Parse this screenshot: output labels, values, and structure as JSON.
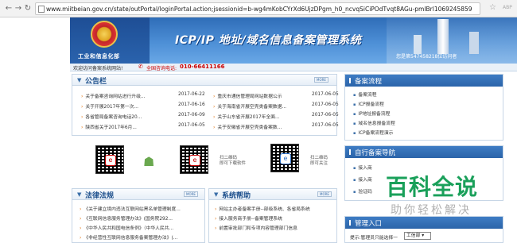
{
  "browser": {
    "url": "www.miitbeian.gov.cn/state/outPortal/loginPortal.action;jsessionid=b-wg4mKobCYrXd6UjzDPgm_h0_ncvqSiCiPOdTvqt8AGu-pmIBrl1069245859"
  },
  "header": {
    "ministry": "工业和信息化部",
    "system_title": "ICP/IP 地址/域名信息备案管理系统",
    "visitor_text": "您是第547458218位访问者"
  },
  "topbar": {
    "welcome": "欢迎访问备案系统网站!",
    "phone_label": "全国咨询电话:",
    "phone": "010-66411166"
  },
  "notices": {
    "title": "公告栏",
    "more": "MORE",
    "left": [
      {
        "title": "关于备案咨询网站进行升级...",
        "date": "2017-06-22"
      },
      {
        "title": "关于开展2017年第一次...",
        "date": "2017-06-16"
      },
      {
        "title": "各省管局备案咨询电话20...",
        "date": "2017-06-09"
      },
      {
        "title": "陕西省关于2017年6月...",
        "date": "2017-06-05"
      }
    ],
    "right": [
      {
        "title": "重庆市通信管理局网站数据公示",
        "date": "2017-06-05"
      },
      {
        "title": "关于海南省开展空壳类备案数据...",
        "date": "2017-06-05"
      },
      {
        "title": "关于山东省开展2017年全面...",
        "date": "2017-06-05"
      },
      {
        "title": "关于安徽省开展空壳类备案数...",
        "date": "2017-06-05"
      }
    ]
  },
  "downloads": {
    "app_label_1": "扫二维码",
    "app_label_2": "即可下载软件",
    "follow_label_1": "扫二维码",
    "follow_label_2": "即可关注"
  },
  "laws": {
    "title": "法律法规",
    "more": "MORE",
    "items": [
      "《关于建立境内违法互联网站黑名单管理制度...",
      "《互联网信息服务管理办法》(国务院292...",
      "《中华人民共和国电信条例》（中华人民共...",
      "《非经营性互联网信息服务备案管理办法》(..."
    ]
  },
  "help": {
    "title": "系统帮助",
    "more": "MORE",
    "items": [
      "网站主办者备案手册--部级系统、各省局系统",
      "接入服务商手册--备案管理系统",
      "前置审批部门和专项内容管理部门信息"
    ]
  },
  "sidebar": {
    "flow_title": "备案流程",
    "flow_items": [
      "备案流程",
      "ICP报备流程",
      "IP地址报备流程",
      "域名信息报备流程",
      "ICP备案流程演示"
    ],
    "nav_title": "自行备案导航",
    "nav_items": [
      "接入商",
      "接入商",
      "验证码"
    ],
    "mgmt_title": "管理入口",
    "hint": "提示:管理员只能选择一",
    "select_value": "工信部"
  },
  "watermark": {
    "main": "百科全说",
    "sub": "助你轻松解决"
  }
}
